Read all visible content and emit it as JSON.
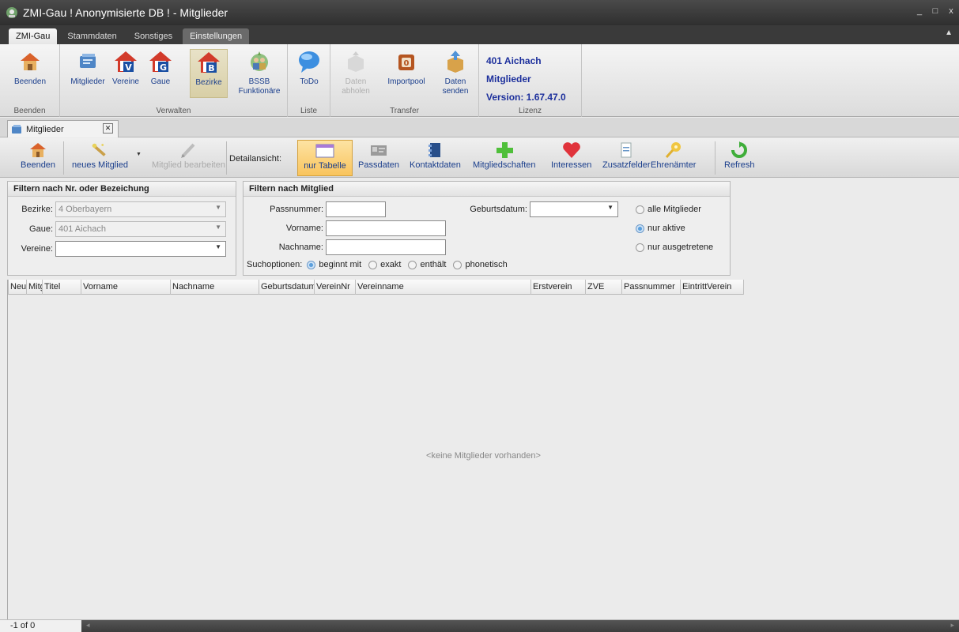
{
  "window": {
    "title": "ZMI-Gau  ! Anonymisierte DB !  - Mitglieder",
    "controls": [
      "_",
      "□",
      "x"
    ]
  },
  "ribbon_tabs": [
    "ZMI-Gau",
    "Stammdaten",
    "Sonstiges",
    "Einstellungen"
  ],
  "ribbon": {
    "groups": {
      "beenden": "Beenden",
      "verwalten": "Verwalten",
      "liste": "Liste",
      "transfer": "Transfer",
      "lizenz": "Lizenz"
    },
    "buttons": {
      "beenden": "Beenden",
      "mitglieder": "Mitglieder",
      "vereine": "Vereine",
      "gaue": "Gaue",
      "bezirke": "Bezirke",
      "bssb_1": "BSSB",
      "bssb_2": "Funktionäre",
      "todo": "ToDo",
      "daten_abholen_1": "Daten",
      "daten_abholen_2": "abholen",
      "importpool": "Importpool",
      "daten_senden_1": "Daten",
      "daten_senden_2": "senden"
    },
    "license": {
      "line1": "401 Aichach",
      "line2": "Mitglieder",
      "line3": "Version: 1.67.47.0"
    }
  },
  "doc_tab": {
    "label": "Mitglieder",
    "close": "✕"
  },
  "toolbar": {
    "beenden": "Beenden",
    "neues_mitglied": "neues Mitglied",
    "mitglied_bearbeiten": "Mitglied bearbeiten",
    "detail_label": "Detailansicht:",
    "nur_tabelle": "nur Tabelle",
    "passdaten": "Passdaten",
    "kontaktdaten": "Kontaktdaten",
    "mitgliedschaften": "Mitgliedschaften",
    "interessen": "Interessen",
    "zusatzfelder": "Zusatzfelder",
    "ehrenaemter": "Ehrenämter",
    "refresh": "Refresh"
  },
  "filter_nr": {
    "title": "Filtern nach Nr. oder Bezeichung",
    "bezirke_label": "Bezirke:",
    "bezirke_value": "4  Oberbayern",
    "gaue_label": "Gaue:",
    "gaue_value": "401  Aichach",
    "vereine_label": "Vereine:",
    "vereine_value": ""
  },
  "filter_mitglied": {
    "title": "Filtern nach Mitglied",
    "passnummer_label": "Passnummer:",
    "vorname_label": "Vorname:",
    "nachname_label": "Nachname:",
    "geburtsdatum_label": "Geburtsdatum:",
    "suchoptionen_label": "Suchoptionen:",
    "such_options": [
      {
        "label": "beginnt mit",
        "checked": true
      },
      {
        "label": "exakt",
        "checked": false
      },
      {
        "label": "enthält",
        "checked": false
      },
      {
        "label": "phonetisch",
        "checked": false
      }
    ],
    "status_options": [
      {
        "label": "alle Mitglieder",
        "checked": false
      },
      {
        "label": "nur aktive",
        "checked": true
      },
      {
        "label": "nur ausgetretene",
        "checked": false
      }
    ]
  },
  "grid": {
    "columns": [
      "Neu",
      "Mitg",
      "Titel",
      "Vorname",
      "Nachname",
      "Geburtsdatum",
      "VereinNr",
      "Vereinname",
      "Erstverein",
      "ZVE",
      "Passnummer",
      "EintrittVerein"
    ],
    "empty_message": "<keine Mitglieder vorhanden>"
  },
  "status": {
    "pager": "-1 of 0",
    "scroll_left": "◂",
    "scroll_right": "▸"
  },
  "colors": {
    "accent_blue": "#1a3e8c",
    "license_blue": "#1c2f9c",
    "active_tab": "#f9c45d"
  }
}
